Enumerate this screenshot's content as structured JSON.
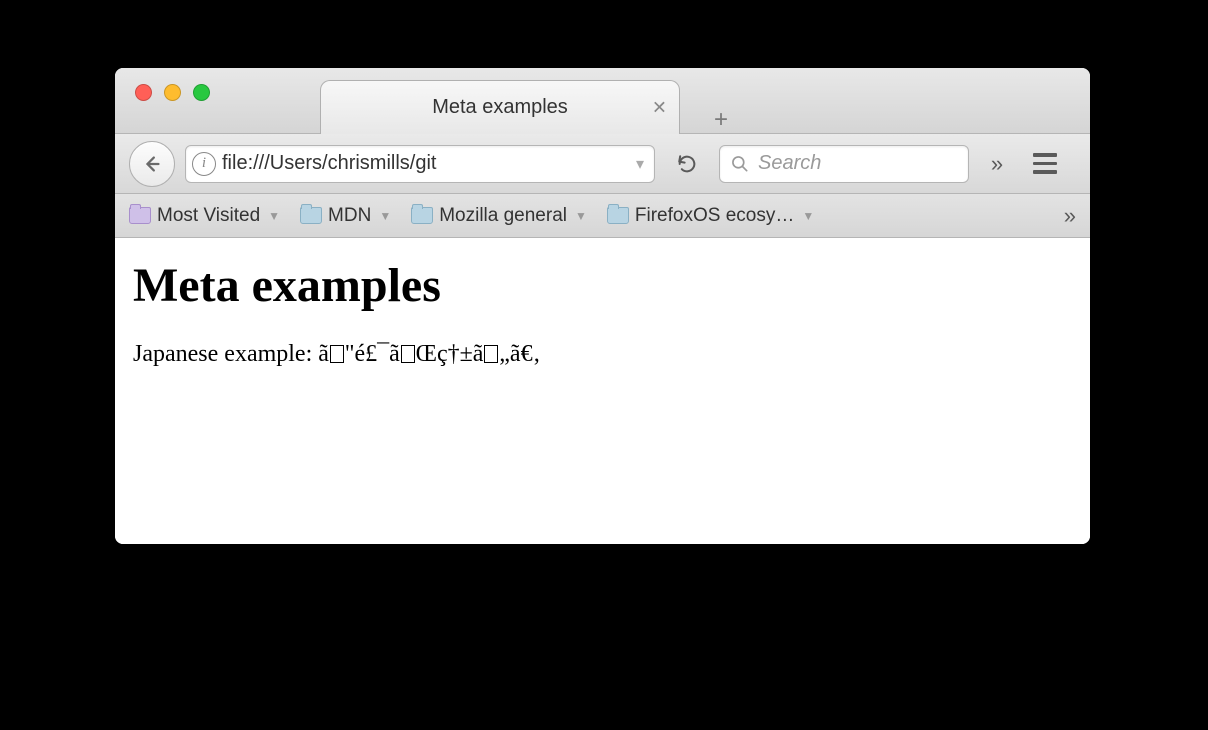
{
  "window": {
    "tab_title": "Meta examples"
  },
  "toolbar": {
    "url": "file:///Users/chrismills/git",
    "search_placeholder": "Search"
  },
  "bookmarks": {
    "items": [
      {
        "label": "Most Visited",
        "folder": "purple"
      },
      {
        "label": "MDN",
        "folder": "blue"
      },
      {
        "label": "Mozilla general",
        "folder": "blue"
      },
      {
        "label": "FirefoxOS ecosy…",
        "folder": "blue"
      }
    ]
  },
  "page": {
    "heading": "Meta examples",
    "paragraph_prefix": "Japanese example: ",
    "mojibake_parts": [
      "ã",
      "\"é£¯ã",
      "Œç†±ã",
      "„ã€‚"
    ]
  }
}
